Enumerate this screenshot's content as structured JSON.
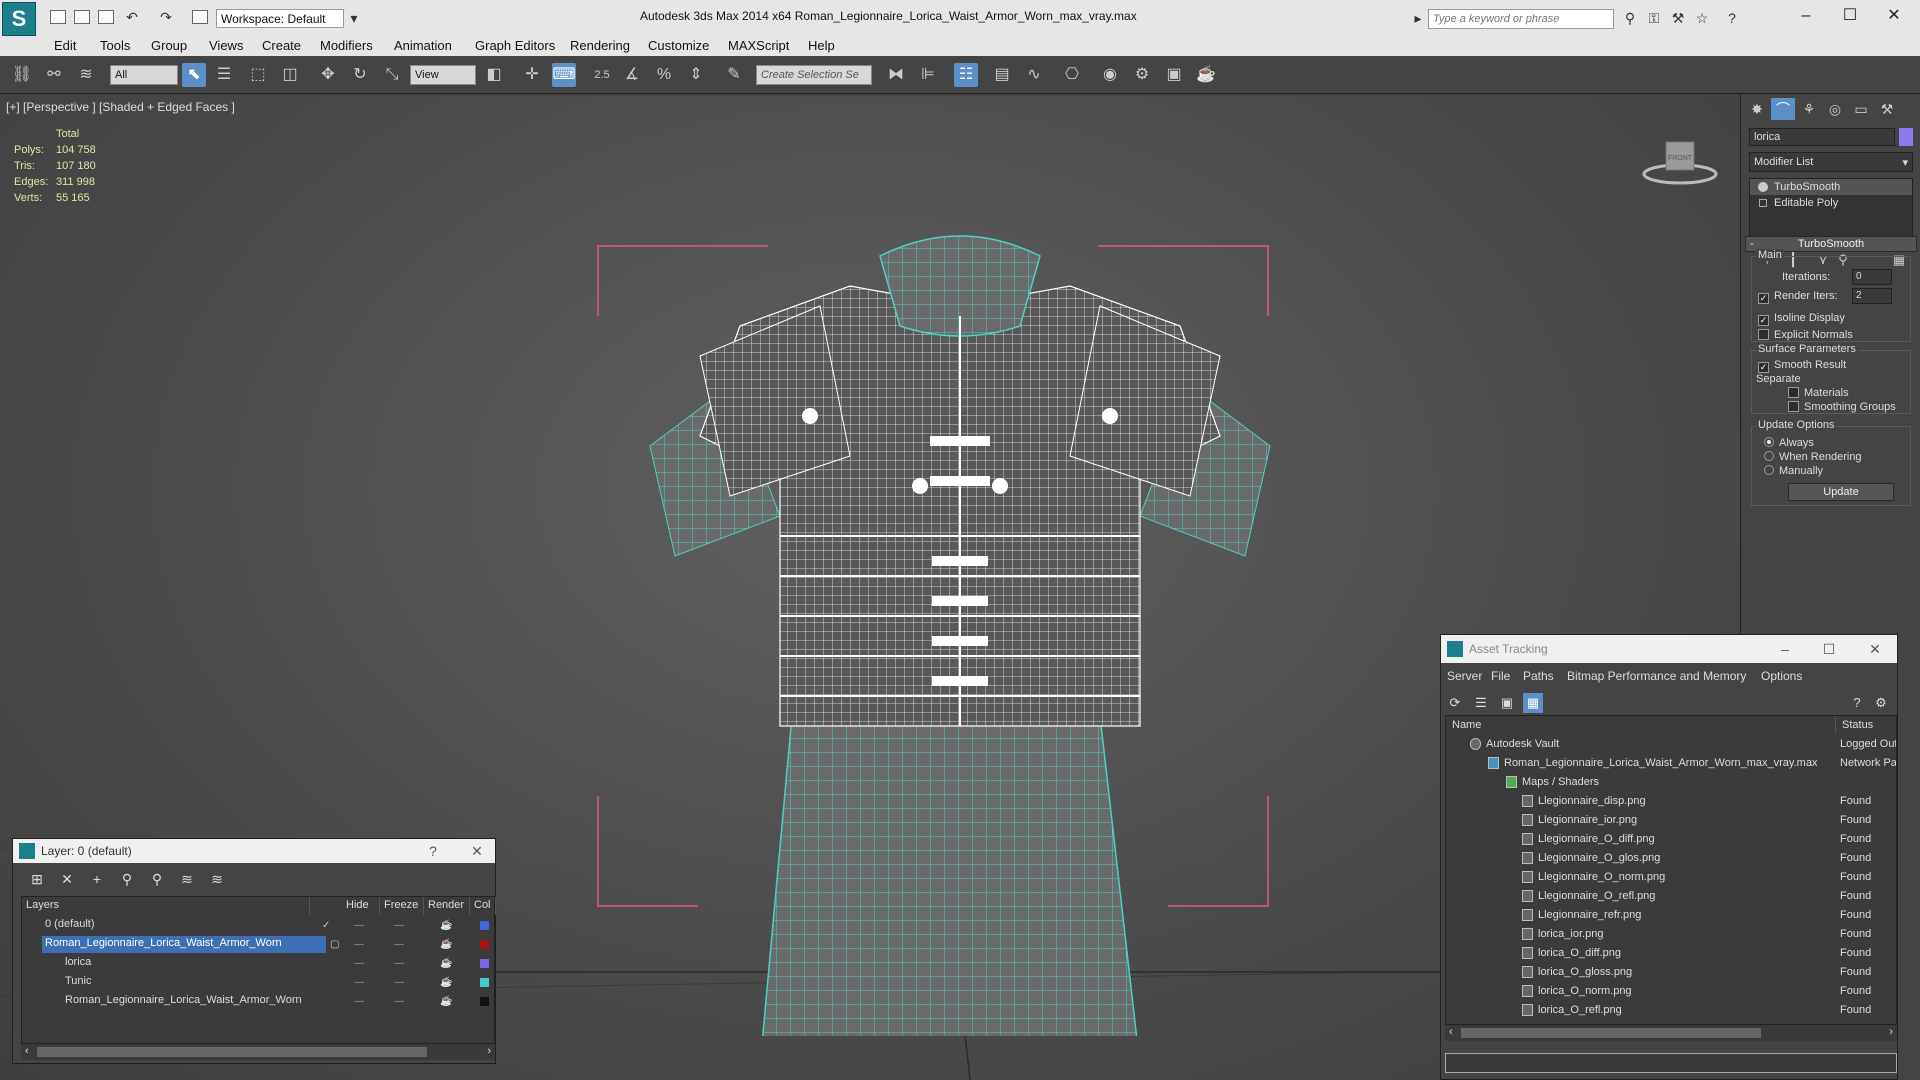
{
  "title_bar": {
    "app_logo": "S",
    "workspace": "Workspace: Default",
    "window_title": "Autodesk 3ds Max  2014 x64      Roman_Legionnaire_Lorica_Waist_Armor_Worn_max_vray.max",
    "search_placeholder": "Type a keyword or phrase"
  },
  "menu": [
    "Edit",
    "Tools",
    "Group",
    "Views",
    "Create",
    "Modifiers",
    "Animation",
    "Graph Editors",
    "Rendering",
    "Customize",
    "MAXScript",
    "Help"
  ],
  "toolbar": {
    "selection_filter": "All",
    "ref_coord": "View",
    "snap_label": "2.5",
    "named_selection_placeholder": "Create Selection Se"
  },
  "viewport": {
    "label": "[+] [Perspective ] [Shaded + Edged Faces ]",
    "stats": {
      "header": "Total",
      "polys_label": "Polys:",
      "polys": "104 758",
      "tris_label": "Tris:",
      "tris": "107 180",
      "edges_label": "Edges:",
      "edges": "311 998",
      "verts_label": "Verts:",
      "verts": "55 165"
    },
    "viewcube_label": "FRONT",
    "wire_color": "#ffffff",
    "mesh_color": "#4fd1c2"
  },
  "command_panel": {
    "object_name": "lorica",
    "modifier_list": "Modifier List",
    "stack": [
      "TurboSmooth",
      "Editable Poly"
    ],
    "rollout": "TurboSmooth",
    "main_group": "Main",
    "iterations_label": "Iterations:",
    "iterations": "0",
    "render_iters_label": "Render Iters:",
    "render_iters": "2",
    "isoline": "Isoline Display",
    "explicit_normals": "Explicit Normals",
    "surface_group": "Surface Parameters",
    "smooth_result": "Smooth Result",
    "separate": "Separate",
    "materials": "Materials",
    "smoothing_groups": "Smoothing Groups",
    "update_group": "Update Options",
    "always": "Always",
    "when_rendering": "When Rendering",
    "manually": "Manually",
    "update_button": "Update"
  },
  "layer_dialog": {
    "title": "Layer: 0 (default)",
    "help": "?",
    "columns": [
      "Layers",
      "Hide",
      "Freeze",
      "Render",
      "Col"
    ],
    "rows": [
      {
        "name": "0 (default)",
        "color": "#4466dd"
      },
      {
        "name": "Roman_Legionnaire_Lorica_Waist_Armor_Worn",
        "color": "#aa1111"
      },
      {
        "name": "lorica",
        "color": "#7766ee"
      },
      {
        "name": "Tunic",
        "color": "#44cccc"
      },
      {
        "name": "Roman_Legionnaire_Lorica_Waist_Armor_Worn",
        "color": "#111111"
      }
    ]
  },
  "asset_tracking": {
    "title": "Asset Tracking",
    "menu": [
      "Server",
      "File",
      "Paths",
      "Bitmap Performance and Memory",
      "Options"
    ],
    "columns": [
      "Name",
      "Status"
    ],
    "rows": [
      {
        "name": "Autodesk Vault",
        "status": "Logged Out"
      },
      {
        "name": "Roman_Legionnaire_Lorica_Waist_Armor_Worn_max_vray.max",
        "status": "Network Path"
      },
      {
        "name": "Maps / Shaders",
        "status": ""
      },
      {
        "name": "Llegionnaire_disp.png",
        "status": "Found"
      },
      {
        "name": "Llegionnaire_ior.png",
        "status": "Found"
      },
      {
        "name": "Llegionnaire_O_diff.png",
        "status": "Found"
      },
      {
        "name": "Llegionnaire_O_glos.png",
        "status": "Found"
      },
      {
        "name": "Llegionnaire_O_norm.png",
        "status": "Found"
      },
      {
        "name": "Llegionnaire_O_refl.png",
        "status": "Found"
      },
      {
        "name": "Llegionnaire_refr.png",
        "status": "Found"
      },
      {
        "name": "lorica_ior.png",
        "status": "Found"
      },
      {
        "name": "lorica_O_diff.png",
        "status": "Found"
      },
      {
        "name": "lorica_O_gloss.png",
        "status": "Found"
      },
      {
        "name": "lorica_O_norm.png",
        "status": "Found"
      },
      {
        "name": "lorica_O_refl.png",
        "status": "Found"
      }
    ]
  }
}
